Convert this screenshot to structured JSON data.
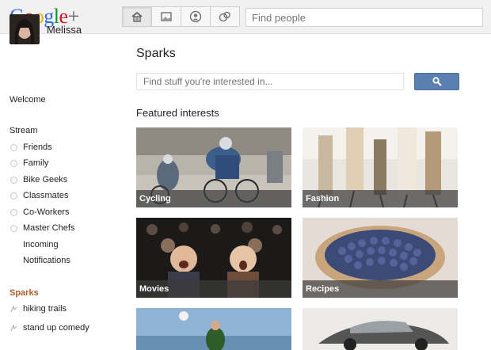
{
  "header": {
    "logo_text": "Google+",
    "nav_icons": [
      "home-icon",
      "photos-icon",
      "profile-icon",
      "circles-icon"
    ],
    "find_people_placeholder": "Find people"
  },
  "sidebar": {
    "profile_name": "Melissa",
    "welcome": "Welcome",
    "stream_heading": "Stream",
    "circles": [
      "Friends",
      "Family",
      "Bike Geeks",
      "Classmates",
      "Co-Workers",
      "Master Chefs"
    ],
    "incoming": "Incoming",
    "notifications": "Notifications",
    "sparks_heading": "Sparks",
    "sparks": [
      "hiking trails",
      "stand up comedy"
    ]
  },
  "main": {
    "title": "Sparks",
    "search_placeholder": "Find stuff you're interested in...",
    "featured_heading": "Featured interests",
    "tiles": [
      "Cycling",
      "Fashion",
      "Movies",
      "Recipes"
    ]
  },
  "colors": {
    "search_button": "#5b7fb0",
    "sparks_accent": "#b05a2a"
  }
}
